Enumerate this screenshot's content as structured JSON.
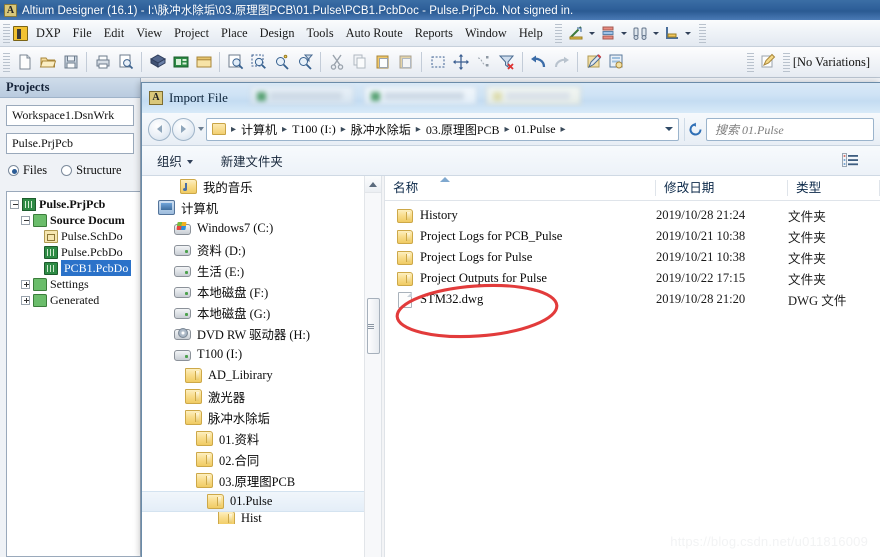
{
  "app": {
    "title": "Altium Designer (16.1) - I:\\脉冲水除垢\\03.原理图PCB\\01.Pulse\\PCB1.PcbDoc - Pulse.PrjPcb. Not signed in.",
    "logo_text": "A"
  },
  "menubar": {
    "items": [
      {
        "label": "DXP"
      },
      {
        "label": "File"
      },
      {
        "label": "Edit"
      },
      {
        "label": "View"
      },
      {
        "label": "Project"
      },
      {
        "label": "Place"
      },
      {
        "label": "Design"
      },
      {
        "label": "Tools"
      },
      {
        "label": "Auto Route"
      },
      {
        "label": "Reports"
      },
      {
        "label": "Window"
      },
      {
        "label": "Help"
      }
    ]
  },
  "toolbar": {
    "variations_label": "[No Variations]",
    "icons": [
      "new-document-icon",
      "open-folder-icon",
      "save-icon",
      "print-icon",
      "print-preview-icon",
      "board-3d-icon",
      "pcb-document-icon",
      "window-icon",
      "zoom-document-icon",
      "zoom-area-icon",
      "zoom-in-icon",
      "zoom-filter-icon",
      "cut-icon",
      "copy-icon",
      "paste-icon",
      "paste-special-icon",
      "select-area-icon",
      "move-icon",
      "align-icon",
      "clear-filter-icon",
      "undo-icon",
      "redo-icon",
      "pencil-icon",
      "browse-icon",
      "pcb-editor-icon"
    ]
  },
  "projects_panel": {
    "header": "Projects",
    "workspace": "Workspace1.DsnWrk",
    "project": "Pulse.PrjPcb",
    "view_modes": [
      {
        "label": "Files",
        "selected": true
      },
      {
        "label": "Structure",
        "selected": false
      }
    ],
    "tree": [
      {
        "label": "Pulse.PrjPcb",
        "icon": "pcb-project-icon",
        "indent": 0,
        "expander": "minus",
        "bold": true,
        "selected": false
      },
      {
        "label": "Source Docum",
        "icon": "folder-icon",
        "indent": 1,
        "expander": "minus",
        "bold": true,
        "selected": false
      },
      {
        "label": "Pulse.SchDo",
        "icon": "schematic-icon",
        "indent": 2,
        "expander": "none",
        "bold": false,
        "selected": false
      },
      {
        "label": "Pulse.PcbDo",
        "icon": "pcb-icon",
        "indent": 2,
        "expander": "none",
        "bold": false,
        "selected": false
      },
      {
        "label": "PCB1.PcbDo",
        "icon": "pcb-icon",
        "indent": 2,
        "expander": "none",
        "bold": false,
        "selected": true
      },
      {
        "label": "Settings",
        "icon": "folder-icon",
        "indent": 1,
        "expander": "plus",
        "bold": false,
        "selected": false
      },
      {
        "label": "Generated",
        "icon": "folder-icon",
        "indent": 1,
        "expander": "plus",
        "bold": false,
        "selected": false
      }
    ]
  },
  "dialog": {
    "title": "Import File",
    "nav": {
      "back_icon": "back-arrow-icon",
      "forward_icon": "forward-arrow-icon",
      "history_icon": "chevron-down-icon",
      "refresh_icon": "refresh-icon",
      "breadcrumbs": [
        "计算机",
        "T100 (I:)",
        "脉冲水除垢",
        "03.原理图PCB",
        "01.Pulse"
      ],
      "search_placeholder": "搜索 01.Pulse"
    },
    "commandbar": {
      "organize": "组织",
      "new_folder": "新建文件夹",
      "view_icon": "view-mode-icon",
      "view_caret": "chevron-down-icon"
    },
    "navtree": [
      {
        "label": "我的音乐",
        "icon": "music-folder-icon",
        "indent": 1,
        "selected": false
      },
      {
        "label": "计算机",
        "icon": "computer-icon",
        "indent": 0,
        "selected": false
      },
      {
        "label": "Windows7 (C:)",
        "icon": "windows-drive-icon",
        "indent": 1,
        "selected": false
      },
      {
        "label": "资料 (D:)",
        "icon": "drive-icon",
        "indent": 1,
        "selected": false
      },
      {
        "label": "生活 (E:)",
        "icon": "drive-icon",
        "indent": 1,
        "selected": false
      },
      {
        "label": "本地磁盘 (F:)",
        "icon": "drive-icon",
        "indent": 1,
        "selected": false
      },
      {
        "label": "本地磁盘 (G:)",
        "icon": "drive-icon",
        "indent": 1,
        "selected": false
      },
      {
        "label": "DVD RW 驱动器 (H:)",
        "icon": "dvd-drive-icon",
        "indent": 1,
        "selected": false
      },
      {
        "label": "T100 (I:)",
        "icon": "drive-icon",
        "indent": 1,
        "selected": false
      },
      {
        "label": "AD_Libirary",
        "icon": "folder-icon",
        "indent": 2,
        "selected": false
      },
      {
        "label": "激光器",
        "icon": "folder-icon",
        "indent": 2,
        "selected": false
      },
      {
        "label": "脉冲水除垢",
        "icon": "folder-icon",
        "indent": 2,
        "selected": false
      },
      {
        "label": "01.资料",
        "icon": "folder-icon",
        "indent": 3,
        "selected": false
      },
      {
        "label": "02.合同",
        "icon": "folder-icon",
        "indent": 3,
        "selected": false
      },
      {
        "label": "03.原理图PCB",
        "icon": "folder-icon",
        "indent": 3,
        "selected": false
      },
      {
        "label": "01.Pulse",
        "icon": "folder-icon",
        "indent": 4,
        "selected": true
      },
      {
        "label": "Hist",
        "icon": "folder-icon",
        "indent": 5,
        "selected": false
      }
    ],
    "filelist": {
      "columns": [
        {
          "label": "名称",
          "sorted": true
        },
        {
          "label": "修改日期",
          "sorted": false
        },
        {
          "label": "类型",
          "sorted": false
        }
      ],
      "rows": [
        {
          "name": "History",
          "icon": "folder-icon",
          "date": "2019/10/28 21:24",
          "type": "文件夹"
        },
        {
          "name": "Project Logs for PCB_Pulse",
          "icon": "folder-icon",
          "date": "2019/10/21 10:38",
          "type": "文件夹"
        },
        {
          "name": "Project Logs for Pulse",
          "icon": "folder-icon",
          "date": "2019/10/21 10:38",
          "type": "文件夹"
        },
        {
          "name": "Project Outputs for Pulse",
          "icon": "folder-icon",
          "date": "2019/10/22 17:15",
          "type": "文件夹"
        },
        {
          "name": "STM32.dwg",
          "icon": "document-icon",
          "date": "2019/10/28 21:20",
          "type": "DWG 文件"
        }
      ]
    },
    "annotation": {
      "shape": "red-ellipse",
      "color": "#e23b3b",
      "target": "STM32.dwg"
    }
  },
  "watermark": "https://blog.csdn.net/u011816009",
  "colors": {
    "title_blue": "#2e5f99",
    "selection_blue": "#2b72c9",
    "annotation_red": "#e23b3b",
    "folder_yellow": "#f0cb63"
  }
}
